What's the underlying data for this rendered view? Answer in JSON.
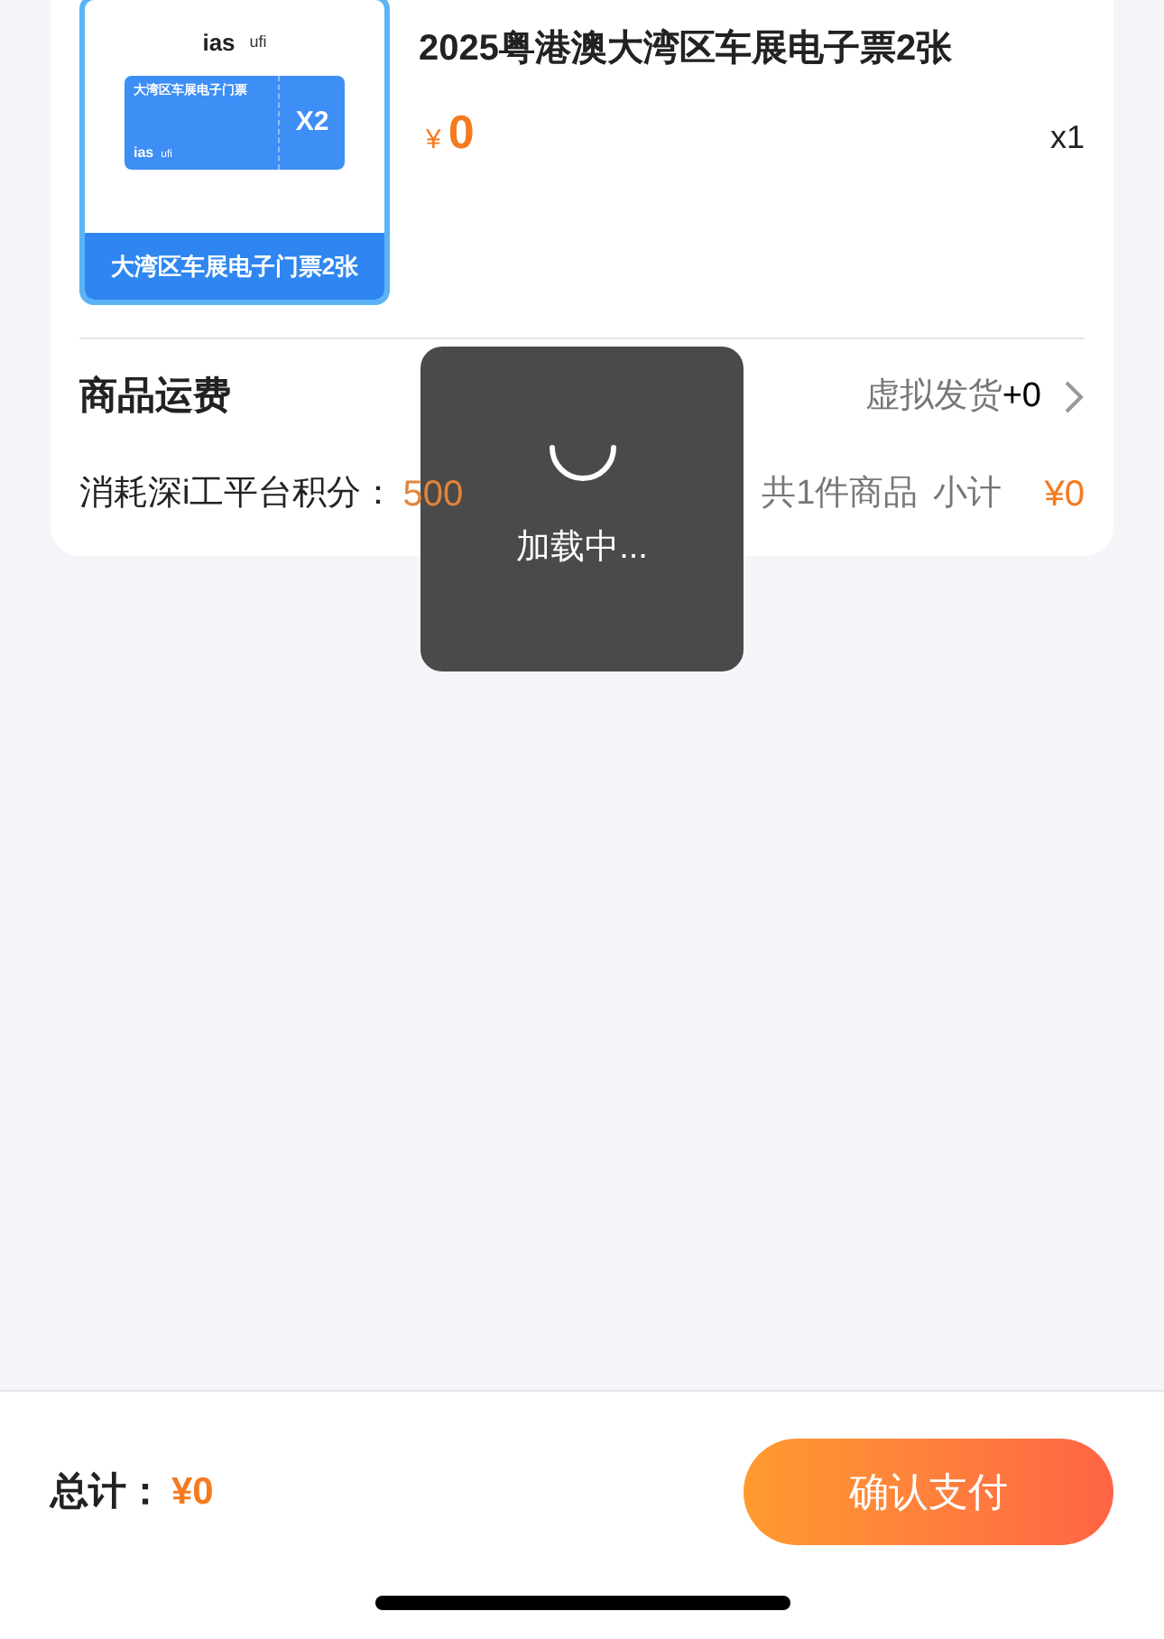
{
  "product": {
    "title": "2025粤港澳大湾区车展电子票2张",
    "currency": "¥",
    "price": "0",
    "quantity": "x1",
    "image": {
      "logo_left": "ias",
      "logo_right": "ufi",
      "ticket_title": "大湾区车展电子门票",
      "ticket_logo_left": "ias",
      "ticket_logo_right": "ufi",
      "ticket_count": "X2",
      "banner": "大湾区车展电子门票2张"
    }
  },
  "shipping": {
    "label": "商品运费",
    "method": "虚拟发货",
    "fee": "+0"
  },
  "points": {
    "label": "消耗深i工平台积分：",
    "value": "500",
    "count_text": "共1件商品",
    "subtotal_label": "小计",
    "subtotal": "¥0"
  },
  "loading_toast": {
    "visible": true,
    "text": "加载中..."
  },
  "footer": {
    "total_label": "总计：",
    "total": "¥0",
    "pay_button": "确认支付"
  }
}
